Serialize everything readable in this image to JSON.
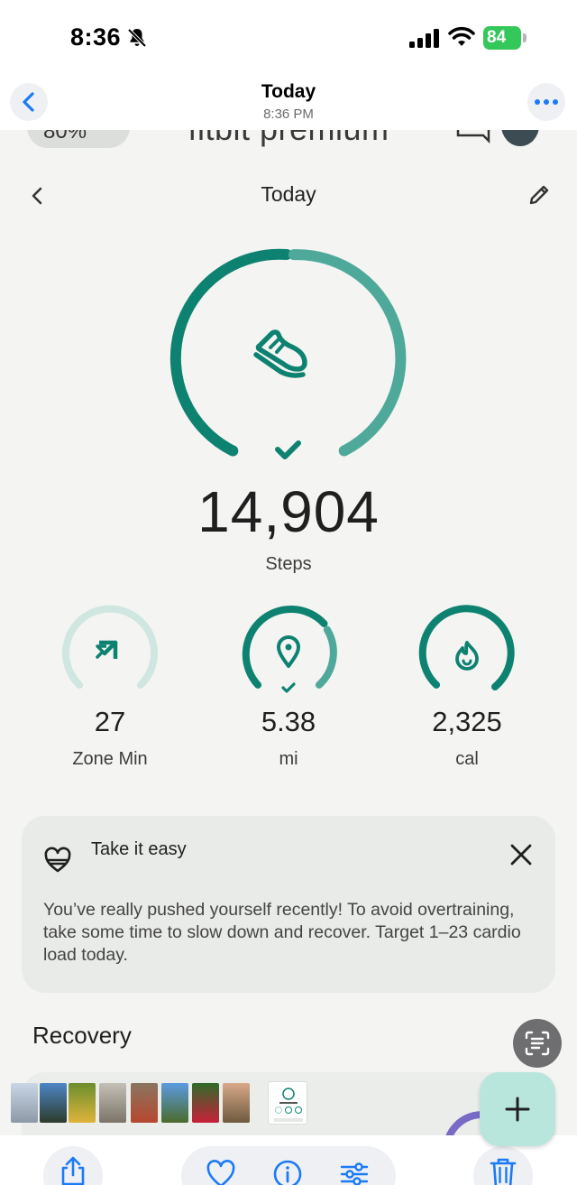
{
  "status_bar": {
    "time": "8:36",
    "battery": "84"
  },
  "viewer": {
    "title": "Today",
    "subtitle": "8:36 PM"
  },
  "app_header": {
    "brand": "fitbit premium",
    "pill_text": "80%"
  },
  "day_nav": {
    "title": "Today"
  },
  "steps": {
    "value": "14,904",
    "label": "Steps",
    "progress_fraction": 1.0
  },
  "metrics": [
    {
      "value": "27",
      "label": "Zone Min",
      "icon": "zone-arrow-icon",
      "progress_fraction": 1.0,
      "goal_met": false
    },
    {
      "value": "5.38",
      "label": "mi",
      "icon": "location-pin-icon",
      "progress_fraction": 1.0,
      "goal_met": true
    },
    {
      "value": "2,325",
      "label": "cal",
      "icon": "flame-icon",
      "progress_fraction": 0.98,
      "goal_met": false
    }
  ],
  "insight": {
    "title": "Take it easy",
    "body": "You’ve really pushed yourself recently! To avoid overtraining, take some time to slow down and recover. Target 1–23 cardio load today."
  },
  "section": {
    "title": "Recovery"
  },
  "colors": {
    "teal_dark": "#0e8271",
    "teal_light": "#4fa99b",
    "teal_faint": "#cfe6e1",
    "ios_blue": "#1a7af8",
    "battery_green": "#34c759"
  }
}
